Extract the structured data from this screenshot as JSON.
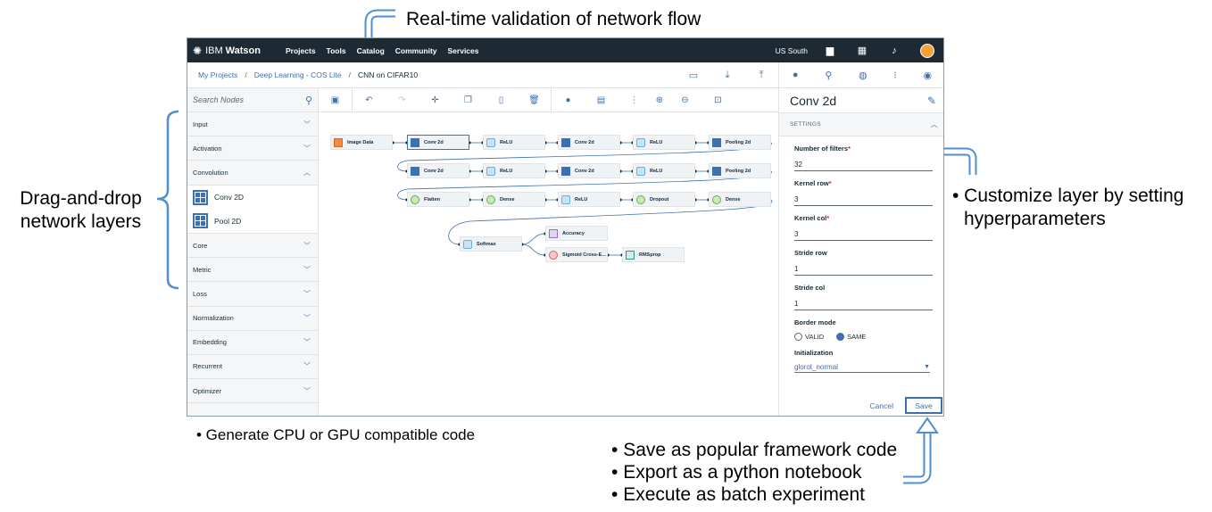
{
  "annotations": {
    "top": "Real-time validation of network flow",
    "left_line1": "Drag-and-drop",
    "left_line2": "network layers",
    "right_line1": "• Customize layer by setting",
    "right_line2": "hyperparameters",
    "bottom_left": "• Generate CPU or GPU compatible code",
    "bottom_right": [
      "Save as popular framework code",
      "Export as a python notebook",
      "Execute as batch experiment"
    ]
  },
  "topnav": {
    "brand_ibm": "IBM",
    "brand_watson": "Watson",
    "items": [
      "Projects",
      "Tools",
      "Catalog",
      "Community",
      "Services"
    ],
    "region": "US South"
  },
  "breadcrumb": {
    "items": [
      "My Projects",
      "Deep Learning - COS Lite"
    ],
    "current": "CNN on CIFAR10"
  },
  "sidebar": {
    "search_placeholder": "Search Nodes",
    "categories_top": [
      "Input",
      "Activation"
    ],
    "open_category": "Convolution",
    "open_items": [
      "Conv 2D",
      "Pool 2D"
    ],
    "categories_bottom": [
      "Core",
      "Metric",
      "Loss",
      "Normalization",
      "Embedding",
      "Recurrent",
      "Optimizer"
    ]
  },
  "canvas": {
    "nodes": [
      {
        "label": "Image Data",
        "color": "orange"
      },
      {
        "label": "Conv 2d",
        "color": "blue",
        "selected": true
      },
      {
        "label": "ReLU",
        "color": "lightblue"
      },
      {
        "label": "Conv 2d",
        "color": "blue"
      },
      {
        "label": "ReLU",
        "color": "lightblue"
      },
      {
        "label": "Pooling 2d",
        "color": "blue"
      },
      {
        "label": "Conv 2d",
        "color": "blue"
      },
      {
        "label": "ReLU",
        "color": "lightblue"
      },
      {
        "label": "Conv 2d",
        "color": "blue"
      },
      {
        "label": "ReLU",
        "color": "lightblue"
      },
      {
        "label": "Pooling 2d",
        "color": "blue"
      },
      {
        "label": "Flatten",
        "color": "green"
      },
      {
        "label": "Dense",
        "color": "green"
      },
      {
        "label": "ReLU",
        "color": "lightblue"
      },
      {
        "label": "Dropout",
        "color": "green"
      },
      {
        "label": "Dense",
        "color": "green"
      },
      {
        "label": "Softmax",
        "color": "lightblue"
      },
      {
        "label": "Accuracy",
        "color": "purple"
      },
      {
        "label": "Sigmoid Cross-E...",
        "color": "red"
      },
      {
        "label": "RMSprop",
        "color": "teal"
      }
    ]
  },
  "panel": {
    "title": "Conv 2d",
    "section": "SETTINGS",
    "filters_label": "Number of filters",
    "filters_value": "32",
    "krow_label": "Kernel row",
    "krow_value": "3",
    "kcol_label": "Kernel col",
    "kcol_value": "3",
    "srow_label": "Stride row",
    "srow_value": "1",
    "scol_label": "Stride col",
    "scol_value": "1",
    "border_label": "Border mode",
    "border_opt1": "VALID",
    "border_opt2": "SAME",
    "border_selected": "SAME",
    "init_label": "Initialization",
    "init_value": "glorot_normal",
    "required_mark": "*",
    "cancel": "Cancel",
    "save": "Save"
  },
  "colors": {
    "accent": "#3d70b2",
    "topnav_bg": "#1d2a33",
    "callout": "#4f8fcf"
  }
}
